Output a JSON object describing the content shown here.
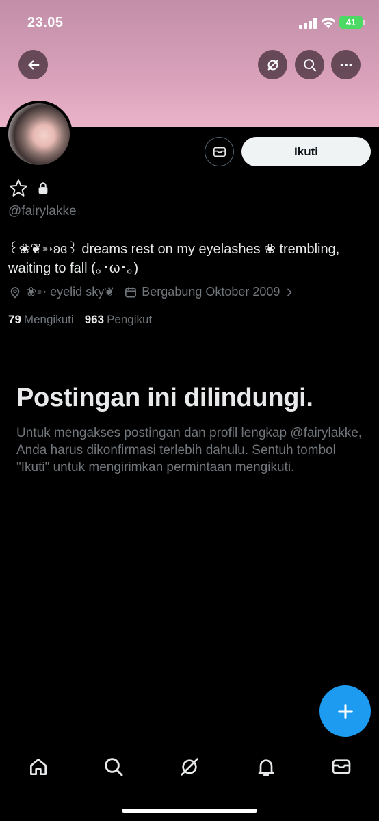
{
  "status_bar": {
    "time": "23.05",
    "battery": "41"
  },
  "profile": {
    "handle": "@fairylakke",
    "bio": "꒰❀❦➳ʚɞ꒱ dreams rest on my eyelashes ❀ trembling, waiting to fall (｡･ω･｡)",
    "location": "❀➳ eyelid sky❦",
    "joined": "Bergabung Oktober 2009",
    "following_count": "79",
    "following_label": "Mengikuti",
    "followers_count": "963",
    "followers_label": "Pengikut"
  },
  "actions": {
    "follow_label": "Ikuti"
  },
  "protected": {
    "title": "Postingan ini dilindungi.",
    "text": "Untuk mengakses postingan dan profil lengkap @fairylakke, Anda harus dikonfirmasi terlebih dahulu. Sentuh tombol \"Ikuti\" untuk mengirimkan permintaan mengikuti."
  },
  "colors": {
    "accent": "#1d9bf0",
    "banner_top": "#c28fa8",
    "banner_bottom": "#ebb3c8",
    "muted": "#71767b"
  },
  "icons": [
    "back-arrow-icon",
    "grok-icon",
    "search-icon",
    "more-icon",
    "envelope-icon",
    "star-icon",
    "lock-icon",
    "location-icon",
    "calendar-icon",
    "chevron-right-icon",
    "plus-icon",
    "home-icon",
    "bell-icon"
  ]
}
